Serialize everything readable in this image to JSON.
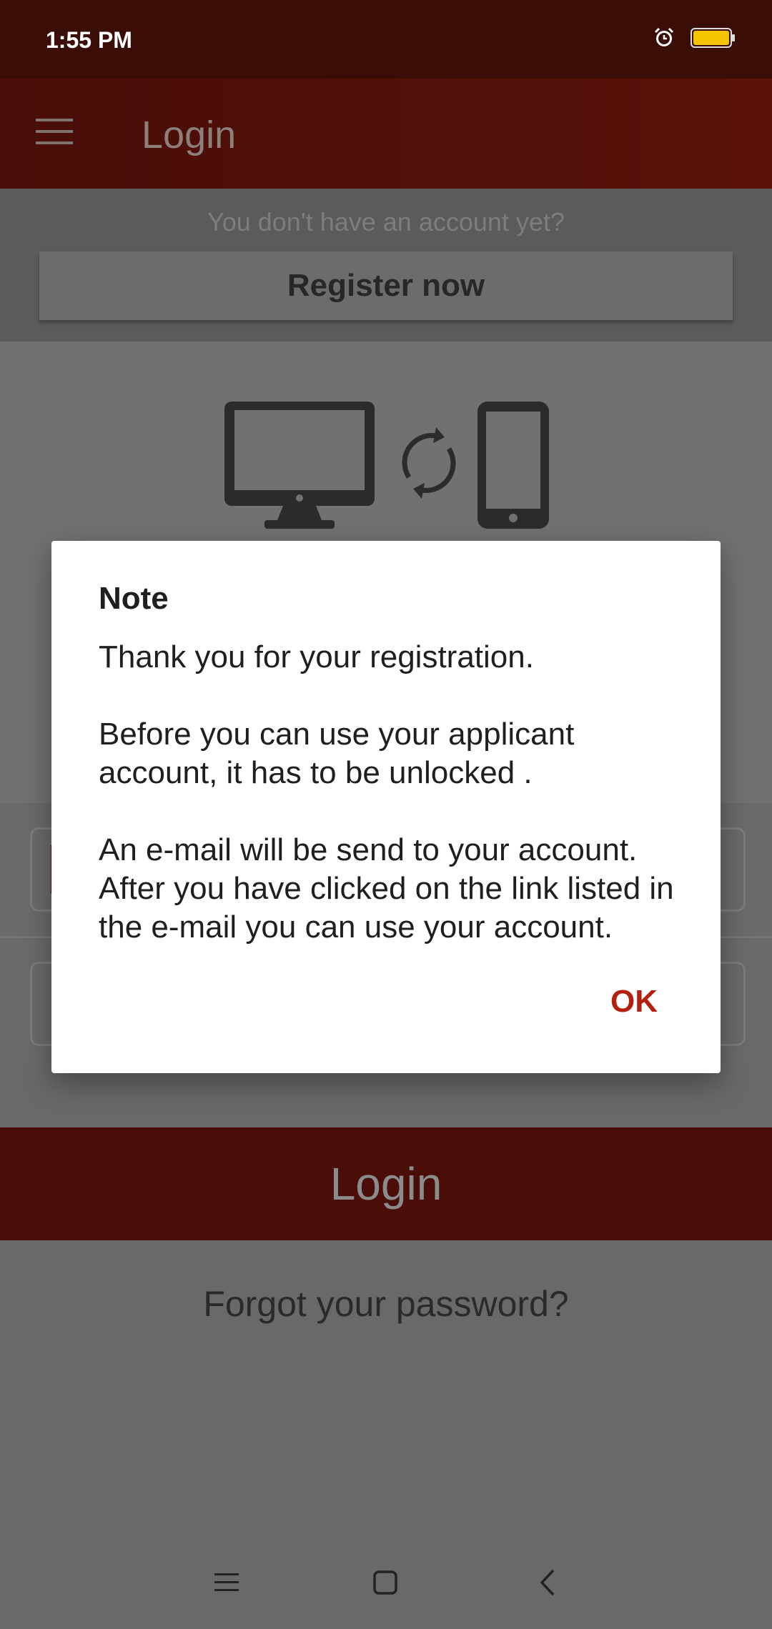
{
  "status_bar": {
    "time": "1:55 PM"
  },
  "app_bar": {
    "title": "Login"
  },
  "register": {
    "prompt": "You don't have an account yet?",
    "button_label": "Register now"
  },
  "login": {
    "button_label": "Login",
    "forgot_password": "Forgot your password?"
  },
  "dialog": {
    "title": "Note",
    "message_lines": [
      "Thank you for your registration.",
      "Before you can use your applicant account, it has to be unlocked .",
      "An e-mail will be send to your account. After you have clicked on the link listed in the e-mail you can use your account."
    ],
    "ok_label": "OK"
  },
  "colors": {
    "accent": "#b3200d",
    "app_bar": "#4a0d07",
    "battery": "#f5c400"
  }
}
